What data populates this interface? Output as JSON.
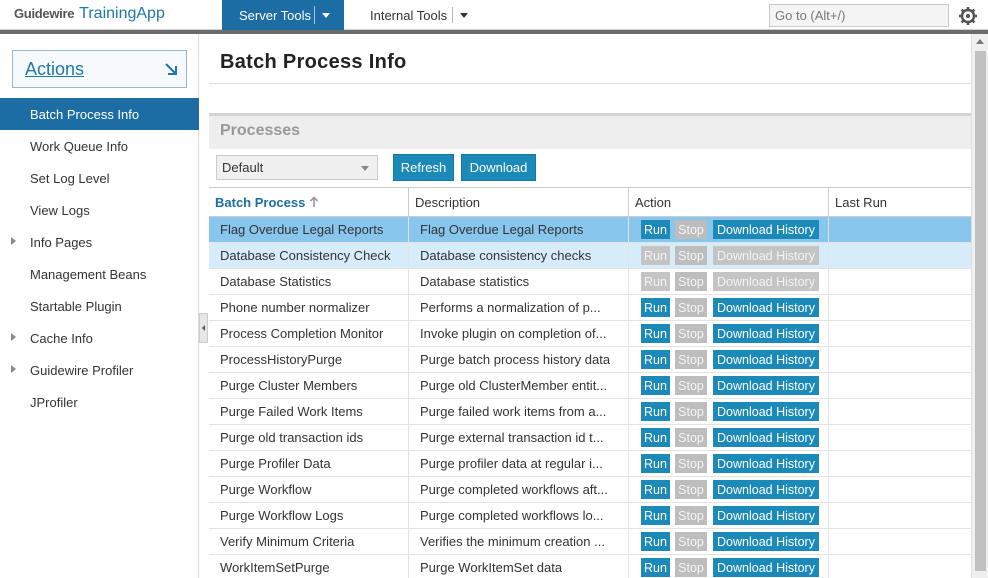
{
  "app": {
    "brand": "Guidewire",
    "name": "TrainingApp"
  },
  "topnav": {
    "server_tools": "Server Tools",
    "internal_tools": "Internal Tools",
    "goto_placeholder": "Go to (Alt+/)"
  },
  "sidebar": {
    "actions_label": "Actions",
    "items": [
      {
        "label": "Batch Process Info",
        "active": true,
        "expandable": false
      },
      {
        "label": "Work Queue Info",
        "active": false,
        "expandable": false
      },
      {
        "label": "Set Log Level",
        "active": false,
        "expandable": false
      },
      {
        "label": "View Logs",
        "active": false,
        "expandable": false
      },
      {
        "label": "Info Pages",
        "active": false,
        "expandable": true
      },
      {
        "label": "Management Beans",
        "active": false,
        "expandable": false
      },
      {
        "label": "Startable Plugin",
        "active": false,
        "expandable": false
      },
      {
        "label": "Cache Info",
        "active": false,
        "expandable": true
      },
      {
        "label": "Guidewire Profiler",
        "active": false,
        "expandable": true
      },
      {
        "label": "JProfiler",
        "active": false,
        "expandable": false
      }
    ]
  },
  "main": {
    "title": "Batch Process Info",
    "section_title": "Processes",
    "filter_value": "Default",
    "refresh_label": "Refresh",
    "download_label": "Download"
  },
  "table": {
    "columns": [
      "Batch Process",
      "Description",
      "Action",
      "Last Run"
    ],
    "action_labels": {
      "run": "Run",
      "stop": "Stop",
      "download_history": "Download History"
    },
    "rows": [
      {
        "name": "Flag Overdue Legal Reports",
        "description": "Flag Overdue Legal Reports",
        "run_enabled": true,
        "dl_enabled": true,
        "state": "selected"
      },
      {
        "name": "Database Consistency Check",
        "description": "Database consistency checks",
        "run_enabled": false,
        "dl_enabled": false,
        "state": "hover"
      },
      {
        "name": "Database Statistics",
        "description": "Database statistics",
        "run_enabled": false,
        "dl_enabled": false,
        "state": ""
      },
      {
        "name": "Phone number normalizer",
        "description": "Performs a normalization of p...",
        "run_enabled": true,
        "dl_enabled": true,
        "state": ""
      },
      {
        "name": "Process Completion Monitor",
        "description": "Invoke plugin on completion of...",
        "run_enabled": true,
        "dl_enabled": true,
        "state": ""
      },
      {
        "name": "ProcessHistoryPurge",
        "description": "Purge batch process history data",
        "run_enabled": true,
        "dl_enabled": true,
        "state": ""
      },
      {
        "name": "Purge Cluster Members",
        "description": "Purge old ClusterMember entit...",
        "run_enabled": true,
        "dl_enabled": true,
        "state": ""
      },
      {
        "name": "Purge Failed Work Items",
        "description": "Purge failed work items from a...",
        "run_enabled": true,
        "dl_enabled": true,
        "state": ""
      },
      {
        "name": "Purge old transaction ids",
        "description": "Purge external transaction id t...",
        "run_enabled": true,
        "dl_enabled": true,
        "state": ""
      },
      {
        "name": "Purge Profiler Data",
        "description": "Purge profiler data at regular i...",
        "run_enabled": true,
        "dl_enabled": true,
        "state": ""
      },
      {
        "name": "Purge Workflow",
        "description": "Purge completed workflows aft...",
        "run_enabled": true,
        "dl_enabled": true,
        "state": ""
      },
      {
        "name": "Purge Workflow Logs",
        "description": "Purge completed workflows lo...",
        "run_enabled": true,
        "dl_enabled": true,
        "state": ""
      },
      {
        "name": "Verify Minimum Criteria",
        "description": "Verifies the minimum creation ...",
        "run_enabled": true,
        "dl_enabled": true,
        "state": ""
      },
      {
        "name": "WorkItemSetPurge",
        "description": "Purge WorkItemSet data",
        "run_enabled": true,
        "dl_enabled": true,
        "state": ""
      }
    ]
  },
  "colors": {
    "primary": "#1b6da3",
    "button": "#1b8ab8",
    "selected_row": "#88c6ee",
    "hover_row": "#d6ecfa"
  },
  "icons": {
    "settings": "gear-icon",
    "actions": "arrow-down-right-icon",
    "sort": "sort-ascending-icon"
  }
}
